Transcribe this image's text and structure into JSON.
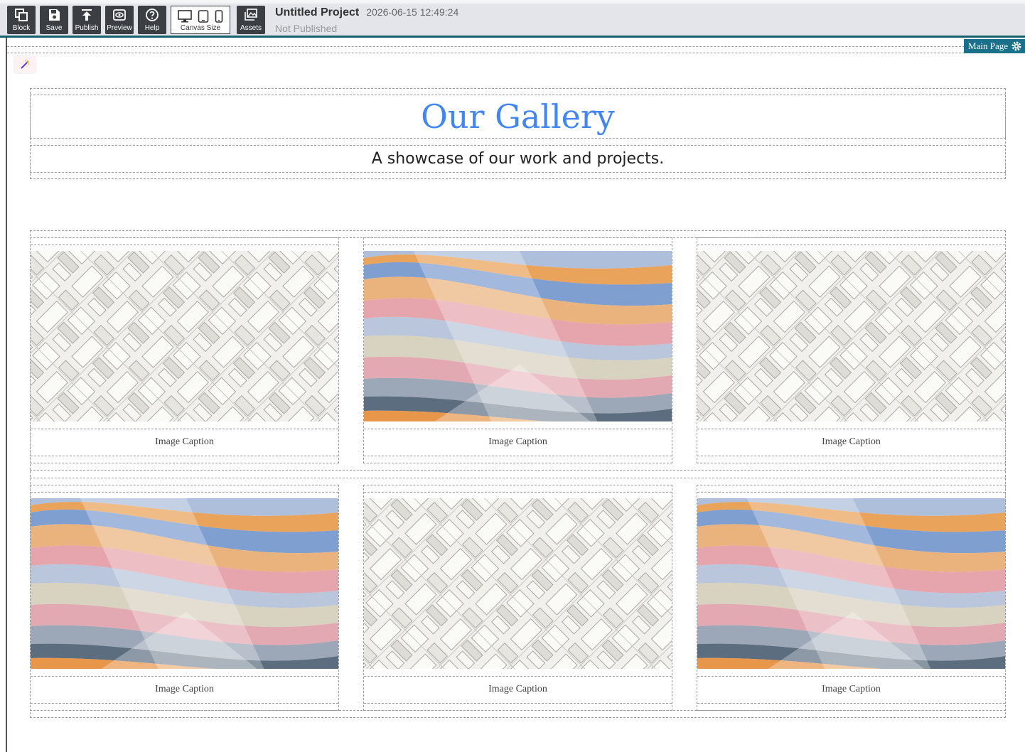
{
  "toolbar": {
    "buttons": [
      {
        "label": "Block",
        "icon": "blocks-icon"
      },
      {
        "label": "Save",
        "icon": "save-icon"
      },
      {
        "label": "Publish",
        "icon": "upload-icon"
      },
      {
        "label": "Preview",
        "icon": "eye-icon"
      },
      {
        "label": "Help",
        "icon": "help-icon"
      }
    ],
    "canvas_size_label": "Canvas Size",
    "assets_label": "Assets"
  },
  "project": {
    "title": "Untitled Project",
    "timestamp": "2026-06-15 12:49:24",
    "status": "Not Published"
  },
  "page_tag": "Main Page",
  "gallery": {
    "title": "Our Gallery",
    "subtitle": "A showcase of our work and projects.",
    "items": [
      {
        "caption": "Image Caption",
        "image": "architecture-isometric"
      },
      {
        "caption": "Image Caption",
        "image": "watercolor-waves"
      },
      {
        "caption": "Image Caption",
        "image": "architecture-isometric"
      },
      {
        "caption": "Image Caption",
        "image": "watercolor-waves"
      },
      {
        "caption": "Image Caption",
        "image": "architecture-isometric"
      },
      {
        "caption": "Image Caption",
        "image": "watercolor-waves"
      }
    ]
  },
  "colors": {
    "toolbar_bg": "#e3e5ea",
    "button_bg": "#3b3f44",
    "accent": "#19708a",
    "title": "#4285f4"
  }
}
